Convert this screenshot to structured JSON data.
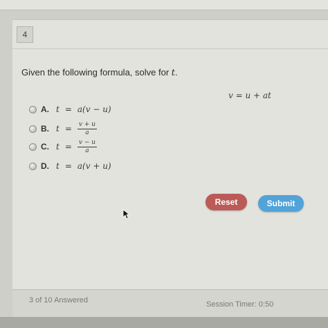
{
  "question": {
    "number": "4",
    "prompt_text": "Given the following formula, solve for ",
    "prompt_var": "t",
    "prompt_end": ".",
    "formula": "v = u + at"
  },
  "options": [
    {
      "letter": "A.",
      "lhs": "t",
      "eq": "=",
      "rhs": "a(v − u)"
    },
    {
      "letter": "B.",
      "lhs": "t",
      "eq": "=",
      "numerator": "v + u",
      "denominator": "a"
    },
    {
      "letter": "C.",
      "lhs": "t",
      "eq": "=",
      "numerator": "v − u",
      "denominator": "a"
    },
    {
      "letter": "D.",
      "lhs": "t",
      "eq": "=",
      "rhs": "a(v + u)"
    }
  ],
  "buttons": {
    "reset": "Reset",
    "submit": "Submit"
  },
  "footer": {
    "answered": "3 of 10 Answered",
    "timer": "Session Timer: 0:50"
  },
  "colors": {
    "reset": "#bb5a56",
    "submit": "#51a3d8"
  }
}
